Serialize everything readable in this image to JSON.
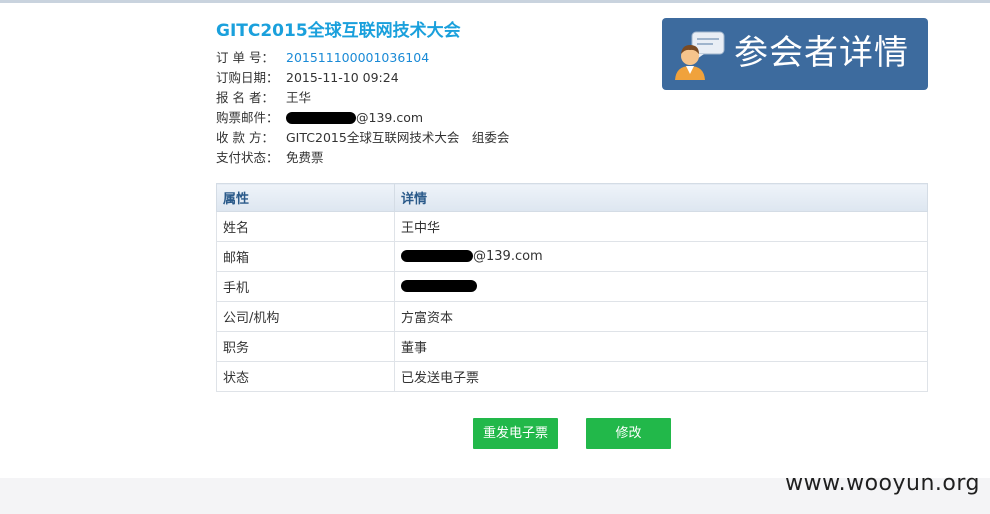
{
  "event_title": "GITC2015全球互联网技术大会",
  "order": [
    {
      "label": "订 单 号：",
      "value": "201511100001036104"
    },
    {
      "label": "订购日期：",
      "value": "2015-11-10 09:24"
    },
    {
      "label": "报 名 者：",
      "value": "王华"
    },
    {
      "label": "购票邮件：",
      "value": "@139.com"
    },
    {
      "label": "收 款 方：",
      "value": "GITC2015全球互联网技术大会　组委会"
    },
    {
      "label": "支付状态：",
      "value": "免费票"
    }
  ],
  "banner": {
    "text": "参会者详情",
    "icon": "user-chat-icon"
  },
  "table": {
    "headers": [
      "属性",
      "详情"
    ],
    "rows": [
      {
        "attr": "姓名",
        "value": "王中华"
      },
      {
        "attr": "邮箱",
        "value": "@139.com"
      },
      {
        "attr": "手机",
        "value": ""
      },
      {
        "attr": "公司/机构",
        "value": "方富资本"
      },
      {
        "attr": "职务",
        "value": "董事"
      },
      {
        "attr": "状态",
        "value": "已发送电子票"
      }
    ]
  },
  "buttons": {
    "resend": "重发电子票",
    "edit": "修改"
  },
  "watermark": "www.wooyun.org",
  "colors": {
    "accent": "#1aa0dc",
    "button": "#22b84a",
    "banner": "#3d6b9e"
  }
}
